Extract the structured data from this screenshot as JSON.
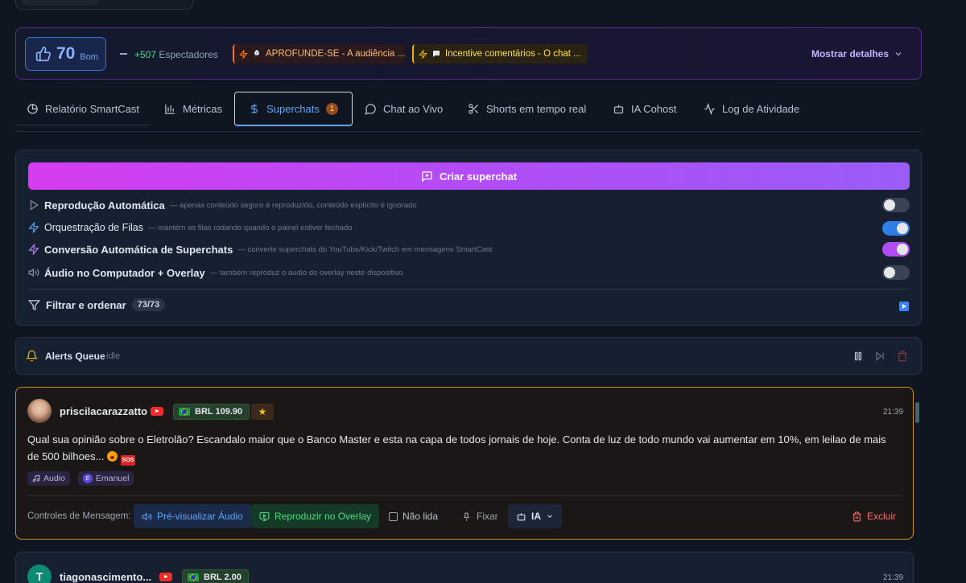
{
  "metrics": {
    "score": "70",
    "score_label": "Bom",
    "viewers_count": "+507",
    "viewers_label": "Espectadores",
    "chip1": "APROFUNDE-SE - A audiência ...",
    "chip2": "Incentive comentários - O chat ...",
    "details": "Mostrar detalhes"
  },
  "tabs": [
    {
      "label": "Relatório SmartCast"
    },
    {
      "label": "Métricas"
    },
    {
      "label": "Superchats",
      "badge": "1"
    },
    {
      "label": "Chat ao Vivo"
    },
    {
      "label": "Shorts em tempo real"
    },
    {
      "label": "IA Cohost"
    },
    {
      "label": "Log de Atividade"
    }
  ],
  "panel": {
    "create_label": "Criar superchat",
    "settings": [
      {
        "title": "Reprodução Automática",
        "desc": "— apenas conteúdo seguro é reproduzido, conteúdo explícito é ignorado",
        "on": false
      },
      {
        "title": "Orquestração de Filas",
        "desc": "— mantém as filas rodando quando o painel estiver fechado",
        "on": true
      },
      {
        "title": "Conversão Automática de Superchats",
        "desc": "— converte superchats do YouTube/Kick/Twitch em mensagens SmartCast",
        "on": true
      },
      {
        "title": "Áudio no Computador + Overlay",
        "desc": "— também reproduz o áudio do overlay neste dispositivo",
        "on": false
      }
    ],
    "filter_label": "Filtrar e ordenar",
    "filter_count": "73/73"
  },
  "alerts": {
    "label": "Alerts Queue",
    "status": "idle"
  },
  "messages": [
    {
      "user": "priscilacarazzatto",
      "amount": "BRL 109.90",
      "time": "21:39",
      "text": "Qual sua opinião sobre o Eletrolão? Escandalo maior que o Banco Master e esta na capa de todos jornais de hoje. Conta de luz de todo mundo vai aumentar em 10%, em leilao de mais de 500 bilhoes...",
      "sos": "SOS",
      "tag_audio": "Audio",
      "tag_voice_initial": "E",
      "tag_voice": "Emanuel",
      "controls_label": "Controles de Mensagem:",
      "preview": "Pré-visualizar Áudio",
      "overlay": "Reproduzir no Overlay",
      "unread": "Não lida",
      "pin": "Fixar",
      "ia": "IA",
      "delete": "Excluir"
    },
    {
      "user": "tiagonascimento...",
      "avatar_initial": "T",
      "amount": "BRL 2.00",
      "time": "21:39"
    }
  ]
}
